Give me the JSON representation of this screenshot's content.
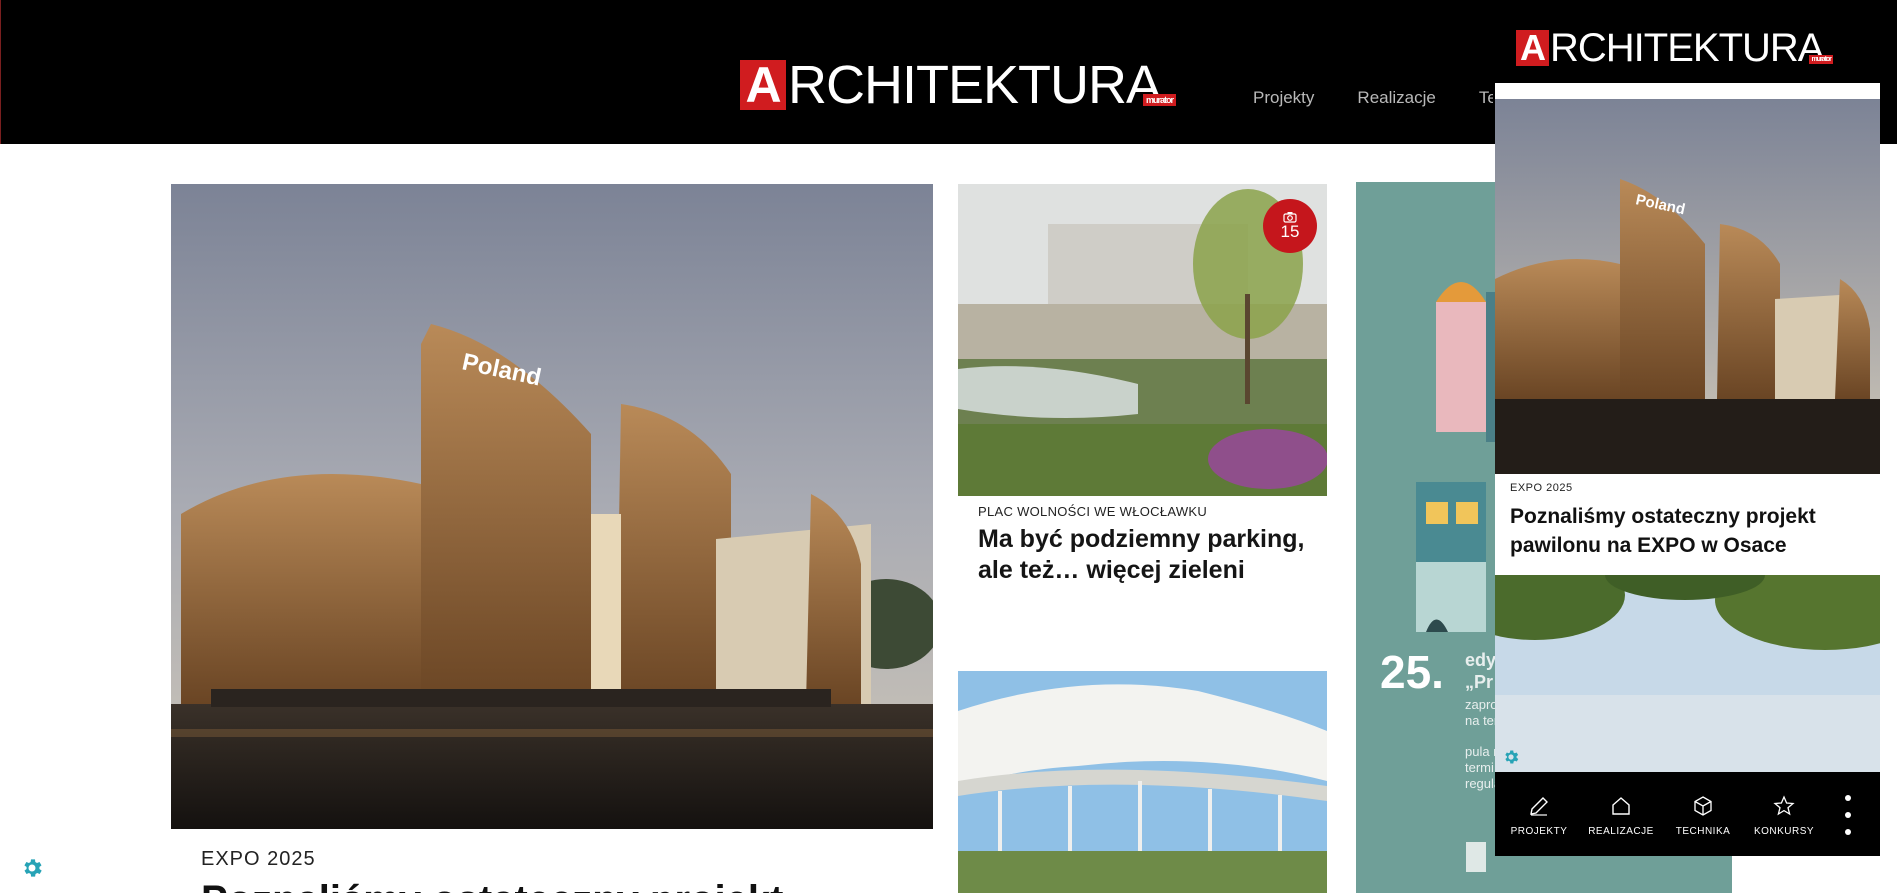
{
  "header": {
    "logo_letter": "A",
    "logo_text": "RCHITEKTURA",
    "logo_sub": "murator",
    "nav": [
      "Projekty",
      "Realizacje",
      "Te"
    ]
  },
  "hero": {
    "kicker": "EXPO 2025",
    "title": "Poznaliśmy ostateczny projekt"
  },
  "card1": {
    "photo_count": "15",
    "kicker": "PLAC WOLNOŚCI WE WŁOCŁAWKU",
    "title": "Ma być podziemny parking, ale też… więcej zieleni"
  },
  "ad": {
    "year": "25.",
    "lines": [
      "edy",
      "„Pr",
      "zapro",
      "na ter",
      "pula n",
      "termi",
      "regula"
    ]
  },
  "popup": {
    "logo_letter": "A",
    "logo_text": "RCHITEKTURA",
    "logo_sub": "murator",
    "kicker": "EXPO 2025",
    "title": "Poznaliśmy ostateczny projekt pawilonu na EXPO w Osace",
    "nav": [
      {
        "label": "PROJEKTY",
        "icon": "pencil-icon"
      },
      {
        "label": "REALIZACJE",
        "icon": "house-icon"
      },
      {
        "label": "TECHNIKA",
        "icon": "cube-icon"
      },
      {
        "label": "KONKURSY",
        "icon": "star-icon"
      }
    ],
    "more_icon": "more-vertical-icon"
  },
  "colors": {
    "brand_red": "#d01c1f",
    "badge_red": "#c5161c",
    "gear_teal": "#27a3b6",
    "ad_teal": "#6f9f98"
  }
}
